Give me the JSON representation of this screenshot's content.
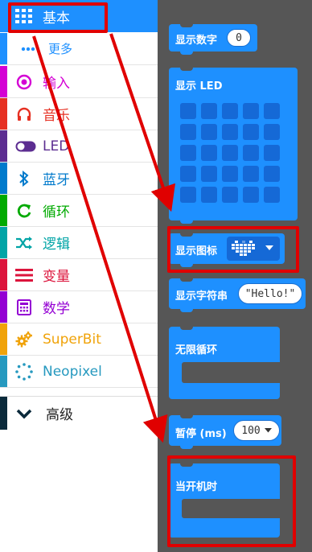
{
  "toolbox": {
    "categories": [
      {
        "key": "basic",
        "label": "基本",
        "icon": "grid-icon",
        "color": "#1e90ff"
      },
      {
        "key": "more",
        "label": "更多",
        "icon": "ellipsis-icon",
        "color": "#1e90ff"
      },
      {
        "key": "input",
        "label": "输入",
        "icon": "radio-button-icon",
        "color": "#d400d4"
      },
      {
        "key": "music",
        "label": "音乐",
        "icon": "headphones-icon",
        "color": "#e63022"
      },
      {
        "key": "led",
        "label": "LED",
        "icon": "toggle-icon",
        "color": "#5c2d91"
      },
      {
        "key": "bluetooth",
        "label": "蓝牙",
        "icon": "bluetooth-icon",
        "color": "#007acc"
      },
      {
        "key": "loops",
        "label": "循环",
        "icon": "refresh-icon",
        "color": "#00aa00"
      },
      {
        "key": "logic",
        "label": "逻辑",
        "icon": "shuffle-icon",
        "color": "#00a4a6"
      },
      {
        "key": "variables",
        "label": "变量",
        "icon": "list-icon",
        "color": "#dc143c"
      },
      {
        "key": "math",
        "label": "数学",
        "icon": "calculator-icon",
        "color": "#9400d3"
      },
      {
        "key": "superbit",
        "label": "SuperBit",
        "icon": "gears-icon",
        "color": "#f0a30a"
      },
      {
        "key": "neopixel",
        "label": "Neopixel",
        "icon": "dotted-circle-icon",
        "color": "#2699bf"
      },
      {
        "key": "advanced",
        "label": "高级",
        "icon": "chevron-down-icon",
        "color": "#0b2a3b"
      }
    ]
  },
  "blocks": {
    "show_number": {
      "label": "显示数字",
      "value": "0"
    },
    "show_leds": {
      "label": "显示 LED"
    },
    "show_icon": {
      "label": "显示图标"
    },
    "show_string": {
      "label": "显示字符串",
      "value": "\"Hello!\""
    },
    "forever": {
      "label": "无限循环"
    },
    "pause": {
      "label": "暂停 (ms)",
      "value": "100"
    },
    "on_start": {
      "label": "当开机时"
    }
  },
  "colors": {
    "block_blue": "#1e90ff",
    "workspace_gray": "#565656",
    "annotation_red": "#e00000"
  }
}
